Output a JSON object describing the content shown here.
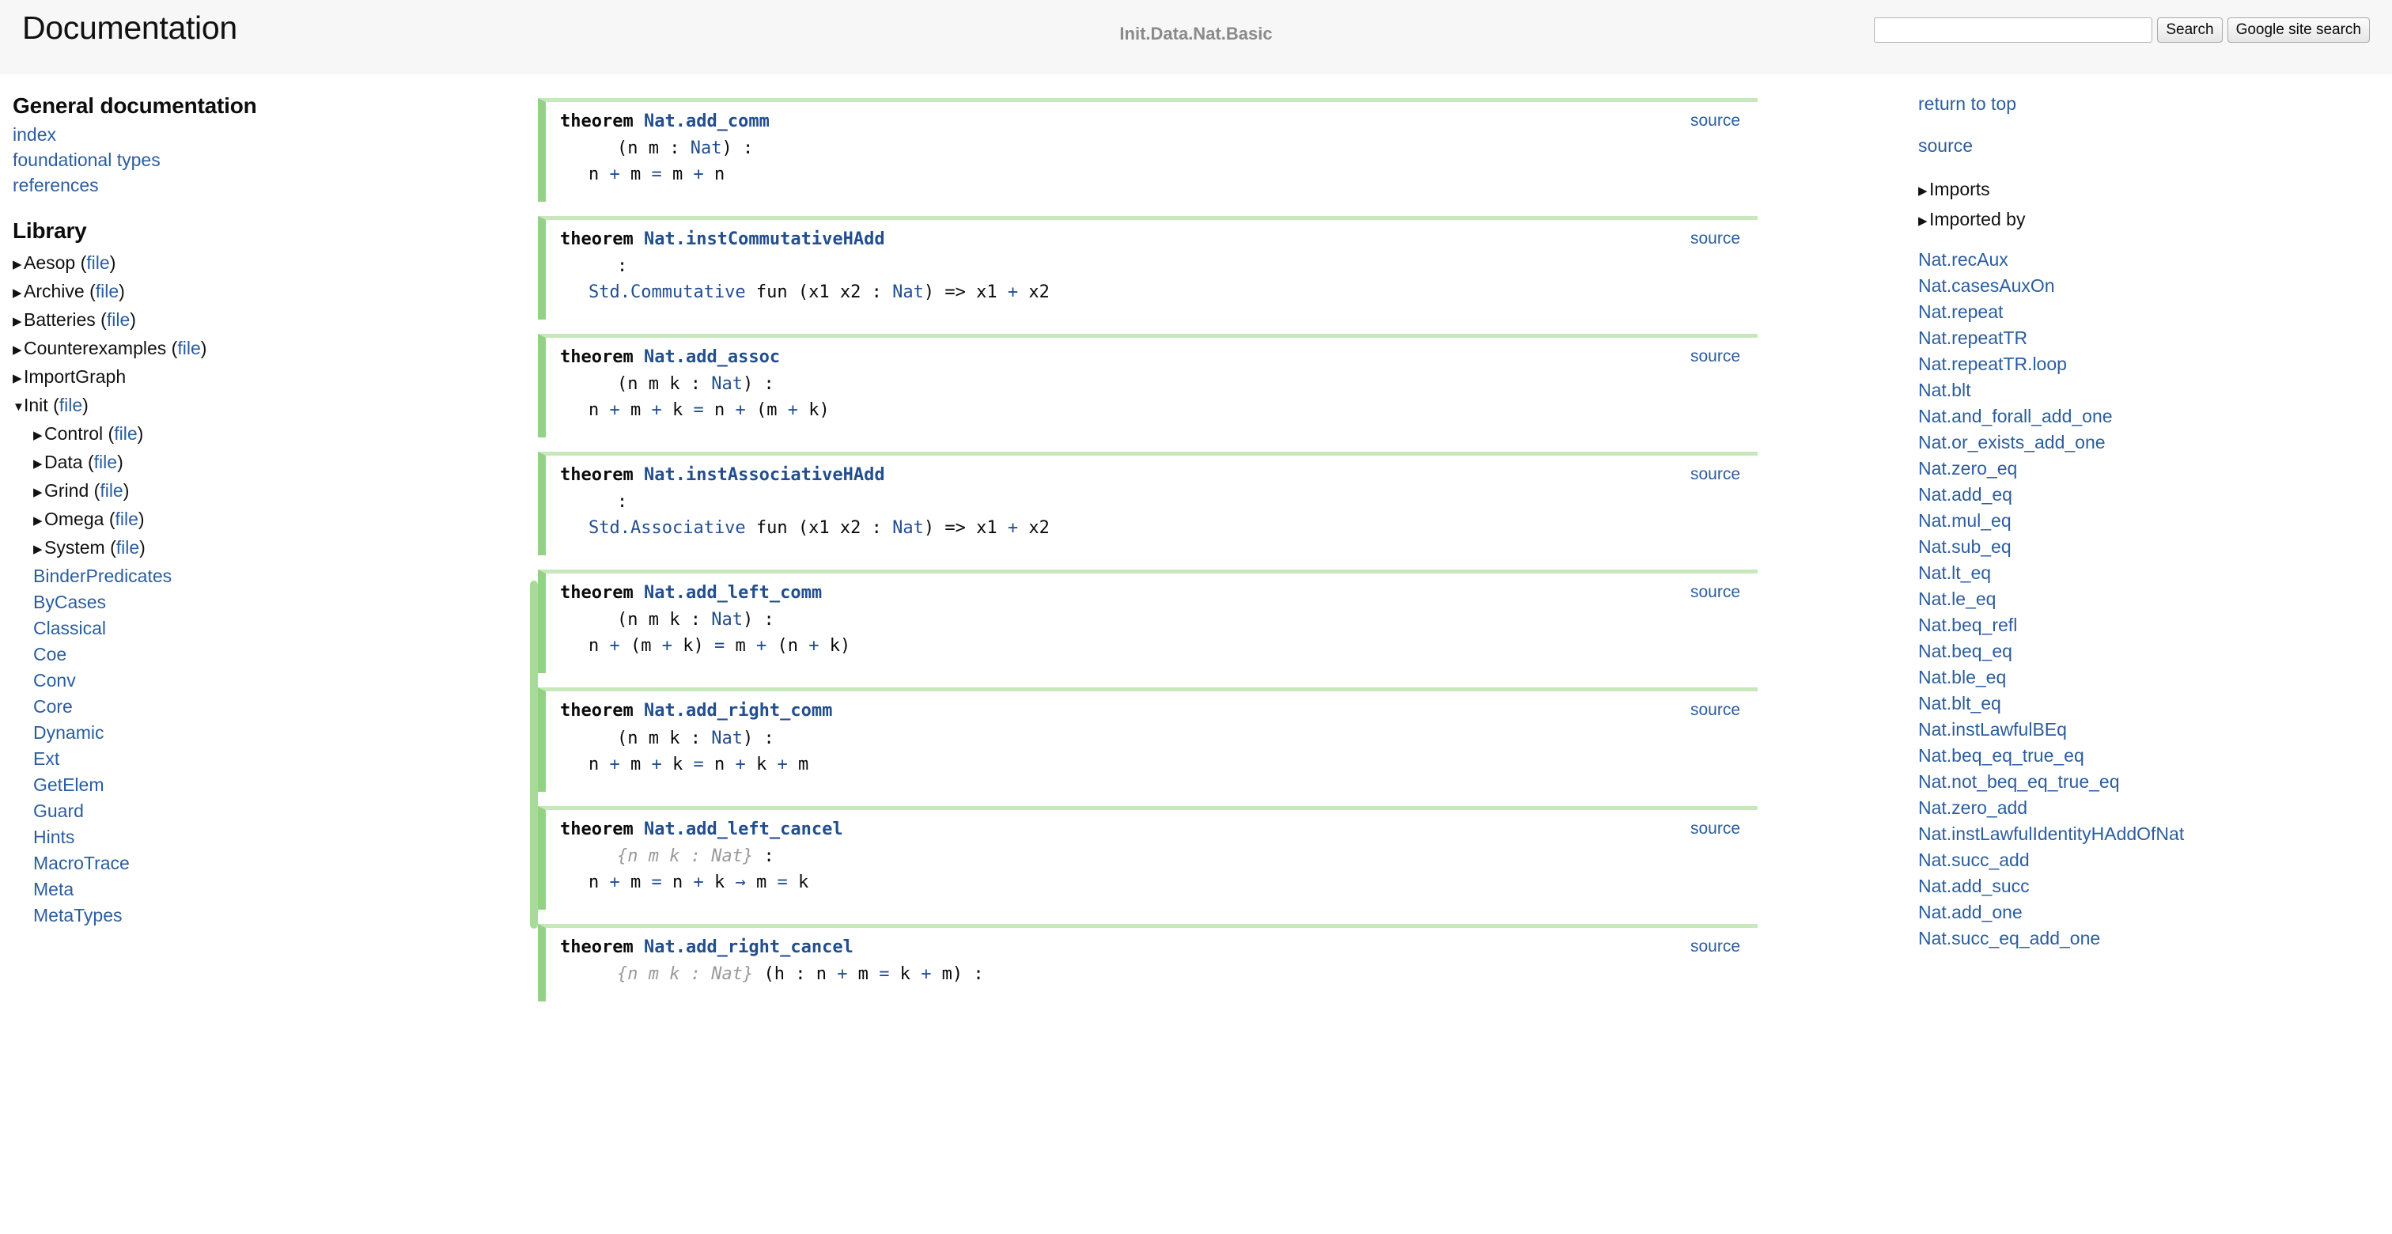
{
  "header": {
    "site_title": "Documentation",
    "module_title": "Init.Data.Nat.Basic",
    "search_value": "",
    "search_placeholder": "",
    "search_button": "Search",
    "google_button": "Google site search"
  },
  "left_nav": {
    "general_heading": "General documentation",
    "general_links": [
      "index",
      "foundational types",
      "references"
    ],
    "library_heading": "Library",
    "file_label": "file",
    "tree": [
      {
        "label": "Aesop",
        "caret": "collapsed",
        "level": 1,
        "file": true
      },
      {
        "label": "Archive",
        "caret": "collapsed",
        "level": 1,
        "file": true
      },
      {
        "label": "Batteries",
        "caret": "collapsed",
        "level": 1,
        "file": true
      },
      {
        "label": "Counterexamples",
        "caret": "collapsed",
        "level": 1,
        "file": true
      },
      {
        "label": "ImportGraph",
        "caret": "collapsed",
        "level": 1,
        "file": false
      },
      {
        "label": "Init",
        "caret": "expanded",
        "level": 1,
        "file": true
      },
      {
        "label": "Control",
        "caret": "collapsed",
        "level": 2,
        "file": true
      },
      {
        "label": "Data",
        "caret": "collapsed",
        "level": 2,
        "file": true
      },
      {
        "label": "Grind",
        "caret": "collapsed",
        "level": 2,
        "file": true
      },
      {
        "label": "Omega",
        "caret": "collapsed",
        "level": 2,
        "file": true
      },
      {
        "label": "System",
        "caret": "collapsed",
        "level": 2,
        "file": true
      }
    ],
    "leaves": [
      "BinderPredicates",
      "ByCases",
      "Classical",
      "Coe",
      "Conv",
      "Core",
      "Dynamic",
      "Ext",
      "GetElem",
      "Guard",
      "Hints",
      "MacroTrace",
      "Meta",
      "MetaTypes"
    ]
  },
  "main": {
    "keyword": "theorem",
    "source_label": "source",
    "declarations": [
      {
        "name": "Nat.add_comm",
        "binders": [
          {
            "text": "(n m : ",
            "style": "plain"
          },
          {
            "text": "Nat",
            "style": "type"
          },
          {
            "text": ") :",
            "style": "plain"
          }
        ],
        "body": [
          {
            "text": "n ",
            "style": "plain"
          },
          {
            "text": "+",
            "style": "op"
          },
          {
            "text": " m ",
            "style": "plain"
          },
          {
            "text": "=",
            "style": "op"
          },
          {
            "text": " m ",
            "style": "plain"
          },
          {
            "text": "+",
            "style": "op"
          },
          {
            "text": " n",
            "style": "plain"
          }
        ]
      },
      {
        "name": "Nat.instCommutativeHAdd",
        "binders": [
          {
            "text": ":",
            "style": "plain"
          }
        ],
        "body": [
          {
            "text": "Std.Commutative",
            "style": "type"
          },
          {
            "text": " fun (x1 x2 : ",
            "style": "plain"
          },
          {
            "text": "Nat",
            "style": "type"
          },
          {
            "text": ") => x1 ",
            "style": "plain"
          },
          {
            "text": "+",
            "style": "op"
          },
          {
            "text": " x2",
            "style": "plain"
          }
        ]
      },
      {
        "name": "Nat.add_assoc",
        "binders": [
          {
            "text": "(n m k : ",
            "style": "plain"
          },
          {
            "text": "Nat",
            "style": "type"
          },
          {
            "text": ") :",
            "style": "plain"
          }
        ],
        "body": [
          {
            "text": "n ",
            "style": "plain"
          },
          {
            "text": "+",
            "style": "op"
          },
          {
            "text": " m ",
            "style": "plain"
          },
          {
            "text": "+",
            "style": "op"
          },
          {
            "text": " k ",
            "style": "plain"
          },
          {
            "text": "=",
            "style": "op"
          },
          {
            "text": " n ",
            "style": "plain"
          },
          {
            "text": "+",
            "style": "op"
          },
          {
            "text": " (m ",
            "style": "plain"
          },
          {
            "text": "+",
            "style": "op"
          },
          {
            "text": " k)",
            "style": "plain"
          }
        ]
      },
      {
        "name": "Nat.instAssociativeHAdd",
        "binders": [
          {
            "text": ":",
            "style": "plain"
          }
        ],
        "body": [
          {
            "text": "Std.Associative",
            "style": "type"
          },
          {
            "text": " fun (x1 x2 : ",
            "style": "plain"
          },
          {
            "text": "Nat",
            "style": "type"
          },
          {
            "text": ") => x1 ",
            "style": "plain"
          },
          {
            "text": "+",
            "style": "op"
          },
          {
            "text": " x2",
            "style": "plain"
          }
        ]
      },
      {
        "name": "Nat.add_left_comm",
        "binders": [
          {
            "text": "(n m k : ",
            "style": "plain"
          },
          {
            "text": "Nat",
            "style": "type"
          },
          {
            "text": ") :",
            "style": "plain"
          }
        ],
        "body": [
          {
            "text": "n ",
            "style": "plain"
          },
          {
            "text": "+",
            "style": "op"
          },
          {
            "text": " (m ",
            "style": "plain"
          },
          {
            "text": "+",
            "style": "op"
          },
          {
            "text": " k) ",
            "style": "plain"
          },
          {
            "text": "=",
            "style": "op"
          },
          {
            "text": " m ",
            "style": "plain"
          },
          {
            "text": "+",
            "style": "op"
          },
          {
            "text": " (n ",
            "style": "plain"
          },
          {
            "text": "+",
            "style": "op"
          },
          {
            "text": " k)",
            "style": "plain"
          }
        ]
      },
      {
        "name": "Nat.add_right_comm",
        "binders": [
          {
            "text": "(n m k : ",
            "style": "plain"
          },
          {
            "text": "Nat",
            "style": "type"
          },
          {
            "text": ") :",
            "style": "plain"
          }
        ],
        "body": [
          {
            "text": "n ",
            "style": "plain"
          },
          {
            "text": "+",
            "style": "op"
          },
          {
            "text": " m ",
            "style": "plain"
          },
          {
            "text": "+",
            "style": "op"
          },
          {
            "text": " k ",
            "style": "plain"
          },
          {
            "text": "=",
            "style": "op"
          },
          {
            "text": " n ",
            "style": "plain"
          },
          {
            "text": "+",
            "style": "op"
          },
          {
            "text": " k ",
            "style": "plain"
          },
          {
            "text": "+",
            "style": "op"
          },
          {
            "text": " m",
            "style": "plain"
          }
        ]
      },
      {
        "name": "Nat.add_left_cancel",
        "binders": [
          {
            "text": "{n m k : ",
            "style": "implicit"
          },
          {
            "text": "Nat",
            "style": "implicit-type"
          },
          {
            "text": "}",
            "style": "implicit"
          },
          {
            "text": " :",
            "style": "plain"
          }
        ],
        "body": [
          {
            "text": "n ",
            "style": "plain"
          },
          {
            "text": "+",
            "style": "op"
          },
          {
            "text": " m ",
            "style": "plain"
          },
          {
            "text": "=",
            "style": "op"
          },
          {
            "text": " n ",
            "style": "plain"
          },
          {
            "text": "+",
            "style": "op"
          },
          {
            "text": " k ",
            "style": "plain"
          },
          {
            "text": "→",
            "style": "op"
          },
          {
            "text": " m ",
            "style": "plain"
          },
          {
            "text": "=",
            "style": "op"
          },
          {
            "text": " k",
            "style": "plain"
          }
        ]
      },
      {
        "name": "Nat.add_right_cancel",
        "binders": [
          {
            "text": "{n m k : ",
            "style": "implicit"
          },
          {
            "text": "Nat",
            "style": "implicit-type"
          },
          {
            "text": "}",
            "style": "implicit"
          },
          {
            "text": " (h : n ",
            "style": "plain"
          },
          {
            "text": "+",
            "style": "op"
          },
          {
            "text": " m ",
            "style": "plain"
          },
          {
            "text": "=",
            "style": "op"
          },
          {
            "text": " k ",
            "style": "plain"
          },
          {
            "text": "+",
            "style": "op"
          },
          {
            "text": " m) :",
            "style": "plain"
          }
        ],
        "body": []
      }
    ]
  },
  "right_nav": {
    "return_to_top": "return to top",
    "source": "source",
    "toggles": [
      "Imports",
      "Imported by"
    ],
    "declarations": [
      "Nat.recAux",
      "Nat.casesAuxOn",
      "Nat.repeat",
      "Nat.repeatTR",
      "Nat.repeatTR.loop",
      "Nat.blt",
      "Nat.and_forall_add_one",
      "Nat.or_exists_add_one",
      "Nat.zero_eq",
      "Nat.add_eq",
      "Nat.mul_eq",
      "Nat.sub_eq",
      "Nat.lt_eq",
      "Nat.le_eq",
      "Nat.beq_refl",
      "Nat.beq_eq",
      "Nat.ble_eq",
      "Nat.blt_eq",
      "Nat.instLawfulBEq",
      "Nat.beq_eq_true_eq",
      "Nat.not_beq_eq_true_eq",
      "Nat.zero_add",
      "Nat.instLawfulIdentityHAddOfNat",
      "Nat.succ_add",
      "Nat.add_succ",
      "Nat.add_one",
      "Nat.succ_eq_add_one"
    ]
  },
  "colors": {
    "accent_green": "#92d283",
    "accent_green_light": "#c6e8bb",
    "link_blue": "#2b5d9e",
    "decl_name_blue": "#234e8e",
    "header_bg": "#f7f7f7",
    "muted_gray": "#8a8a8a"
  }
}
